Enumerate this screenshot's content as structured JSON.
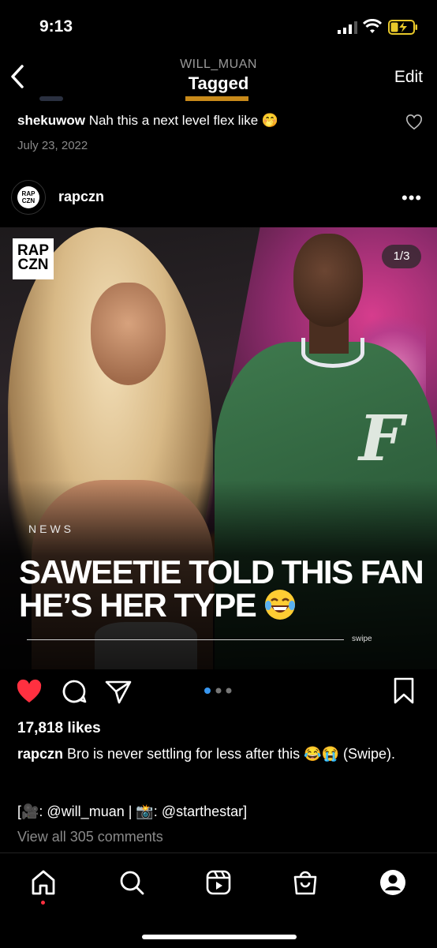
{
  "status_bar": {
    "time": "9:13"
  },
  "header": {
    "account": "WILL_MUAN",
    "title": "Tagged",
    "edit_label": "Edit"
  },
  "prev_comment": {
    "username": "shekuwow",
    "text": " Nah this a next level flex like 🤭",
    "date": "July 23, 2022"
  },
  "post": {
    "username": "rapczn",
    "avatar_text": "RAP CZN",
    "logo_line1": "RAP",
    "logo_line2": "CZN",
    "counter": "1/3",
    "overlay_label": "NEWS",
    "headline": "SAWEETIE TOLD THIS FAN HE’S HER TYPE",
    "swipe_label": "swipe",
    "likes": "17,818 likes",
    "caption_username": "rapczn",
    "caption_text": " Bro is never settling for less after this 😂😭 (Swipe).",
    "credits": "[🎥: @will_muan | 📸: @starthestar]",
    "view_all": "View all 305 comments",
    "carousel_index": 1,
    "carousel_total": 3
  },
  "colors": {
    "like": "#ff3040",
    "active_dot": "#3897f0",
    "muted": "#8a8a8a"
  },
  "icons": [
    "back-arrow-icon",
    "signal-icon",
    "wifi-icon",
    "battery-icon",
    "heart-icon",
    "more-icon",
    "comment-icon",
    "share-icon",
    "bookmark-icon",
    "home-icon",
    "search-icon",
    "reels-icon",
    "shop-icon",
    "profile-icon"
  ]
}
